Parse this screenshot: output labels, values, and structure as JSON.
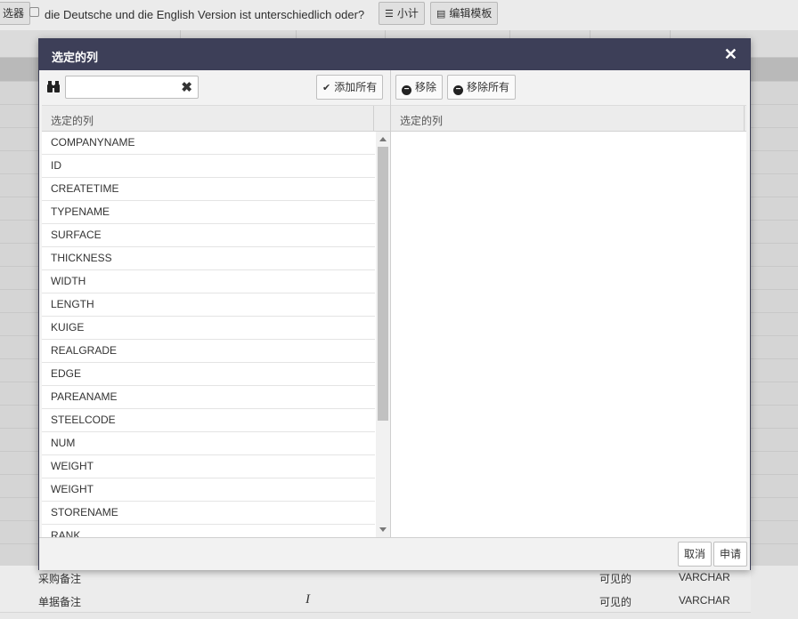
{
  "toolbar": {
    "filter_label": "选器",
    "checkbox_label": "die Deutsche und die English Version ist unterschiedlich oder?",
    "subtotal_label": "小计",
    "edit_template_label": "编辑模板"
  },
  "dialog": {
    "title": "选定的列",
    "left": {
      "column_header": "选定的列",
      "search_value": "",
      "add_all_label": "添加所有",
      "items": [
        "COMPANYNAME",
        "ID",
        "CREATETIME",
        "TYPENAME",
        "SURFACE",
        "THICKNESS",
        "WIDTH",
        "LENGTH",
        "KUIGE",
        "REALGRADE",
        "EDGE",
        "PAREANAME",
        "STEELCODE",
        "NUM",
        "WEIGHT",
        "WEIGHT",
        "STORENAME",
        "RANK"
      ]
    },
    "right": {
      "column_header": "选定的列",
      "remove_label": "移除",
      "remove_all_label": "移除所有"
    },
    "footer": {
      "cancel_label": "取消",
      "apply_label": "申请"
    }
  },
  "background_rows": [
    {
      "name": "采购备注",
      "visibility": "可见的",
      "type": "VARCHAR"
    },
    {
      "name": "单据备注",
      "visibility": "可见的",
      "type": "VARCHAR"
    }
  ],
  "colors": {
    "dialog_title_bg": "#3d3f58",
    "dialog_bg": "#f2f2f2",
    "scroll_thumb": "#c1c1c1"
  }
}
